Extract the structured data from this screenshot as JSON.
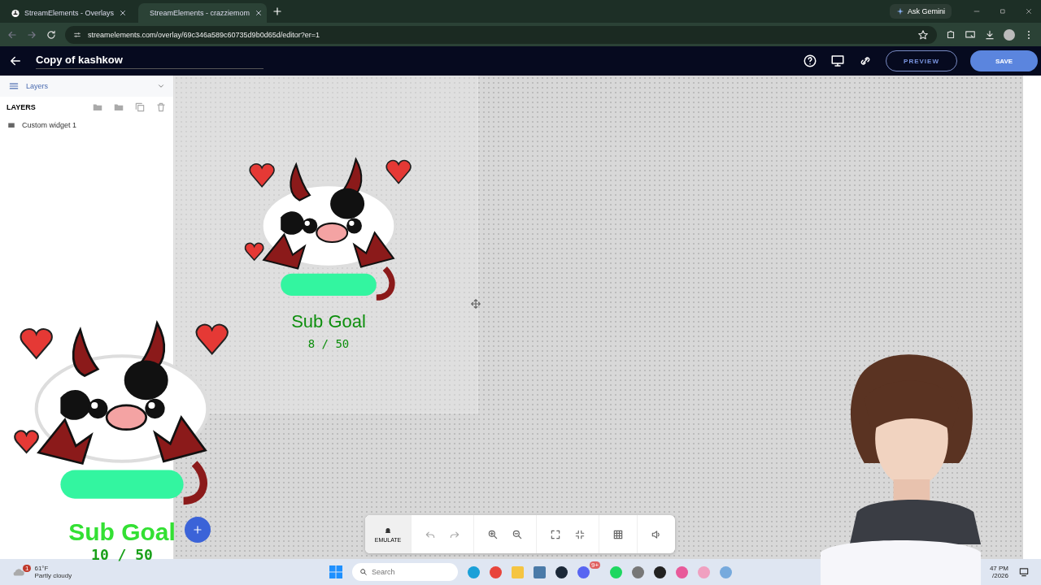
{
  "browser": {
    "tabs": [
      {
        "title": "StreamElements - Overlays",
        "selected": false
      },
      {
        "title": "StreamElements - crazziemom",
        "selected": true
      }
    ],
    "ask_gemini": "Ask Gemini",
    "url": "streamelements.com/overlay/69c346a589c60735d9b0d65d/editor?er=1"
  },
  "editor": {
    "title": "Copy of kashkow",
    "preview": "PREVIEW",
    "save": "SAVE"
  },
  "sidebar": {
    "dropdown": "Layers",
    "heading": "LAYERS",
    "layers": [
      {
        "name": "Custom widget 1"
      }
    ]
  },
  "canvas": {
    "widget": {
      "title": "Sub Goal",
      "progress": "8 / 50"
    }
  },
  "toolbar": {
    "emulate": "EMULATE"
  },
  "stream_overlay": {
    "title": "Sub Goal",
    "progress": "10 / 50"
  },
  "taskbar": {
    "weather": {
      "temperature": "61°F",
      "condition": "Partly cloudy",
      "badge": "1"
    },
    "search": {
      "placeholder": "Search"
    },
    "discord_badge": "9+",
    "time": "47 PM",
    "date": "/2026"
  }
}
